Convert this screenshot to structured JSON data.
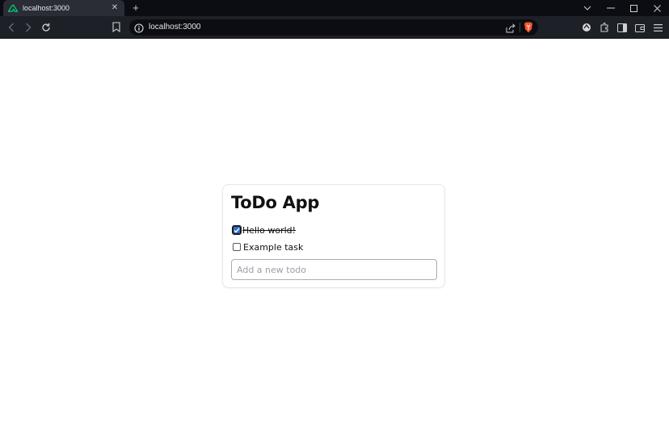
{
  "browser": {
    "tab_title": "localhost:3000",
    "tab_close": "✕",
    "new_tab": "+",
    "url": "localhost:3000",
    "icons": [
      "nuxt-favicon-icon",
      "back-arrow-icon",
      "forward-arrow-icon",
      "reload-icon",
      "bookmark-icon",
      "info-icon",
      "share-icon",
      "brave-shield-icon",
      "leo-ai-icon",
      "extensions-icon",
      "sidebar-icon",
      "wallet-icon",
      "menu-icon",
      "chevron-down-icon",
      "minimize-icon",
      "maximize-icon",
      "close-window-icon"
    ]
  },
  "app": {
    "title": "ToDo App",
    "todos": [
      {
        "label": "Hello world!",
        "done": true
      },
      {
        "label": "Example task",
        "done": false
      }
    ],
    "input_placeholder": "Add a new todo",
    "input_value": ""
  },
  "colors": {
    "tabstrip_bg": "#0b0d12",
    "toolbar_bg": "#1e2027",
    "checkbox_checked": "#2f6fd6",
    "brave_orange": "#fb542b",
    "nuxt_green": "#00dc82"
  }
}
